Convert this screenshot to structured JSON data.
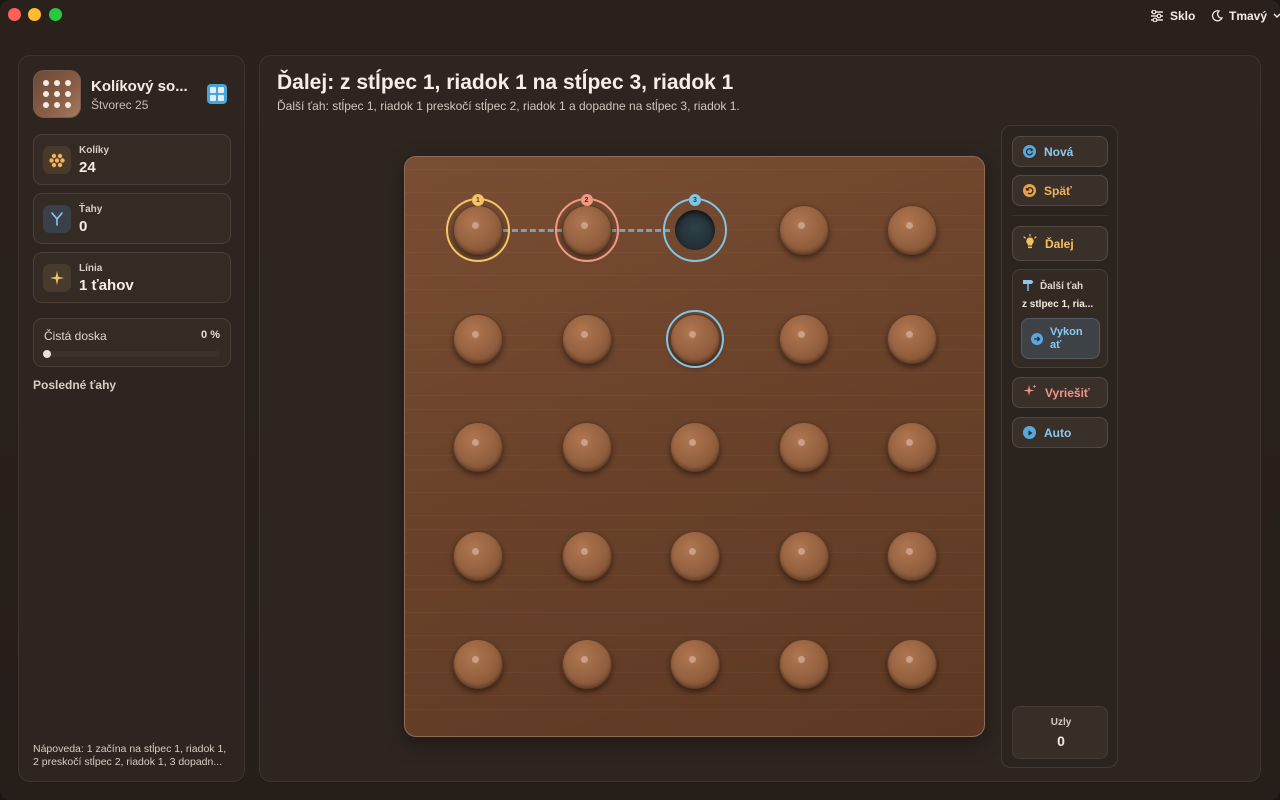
{
  "titlebar": {
    "glass_label": "Sklo",
    "theme_label": "Tmavý"
  },
  "sidebar": {
    "app_title": "Kolíkový so...",
    "app_subtitle": "Štvorec 25",
    "stats": [
      {
        "label": "Kolíky",
        "value": "24",
        "icon": "pegs-icon",
        "color": "#f2b25c"
      },
      {
        "label": "Ťahy",
        "value": "0",
        "icon": "moves-icon",
        "color": "#8cc8ee"
      },
      {
        "label": "Línia",
        "value": "1 ťahov",
        "icon": "sparkle-icon",
        "color": "#f2c163"
      }
    ],
    "progress": {
      "label": "Čistá doska",
      "percent_label": "0 %",
      "fraction": 0
    },
    "recent_title": "Posledné ťahy",
    "hint": "Nápoveda: 1 začína na stĺpec 1, riadok 1, 2 preskočí stĺpec 2, riadok 1, 3 dopadn..."
  },
  "main": {
    "title": "Ďalej: z stĺpec 1, riadok 1 na stĺpec 3, riadok 1",
    "subtitle": "Ďalší ťah: stĺpec 1, riadok 1 preskočí stĺpec 2, riadok 1 a dopadne na stĺpec 3, riadok 1."
  },
  "board": {
    "rows": 5,
    "cols": 5,
    "empty": [
      [
        1,
        3
      ]
    ],
    "highlights": [
      {
        "col": 1,
        "row": 1,
        "style": "yellow",
        "badge": "1"
      },
      {
        "col": 2,
        "row": 1,
        "style": "red",
        "badge": "2"
      },
      {
        "col": 3,
        "row": 1,
        "style": "blue",
        "badge": "3"
      },
      {
        "col": 3,
        "row": 2,
        "style": "blue2",
        "badge": ""
      }
    ]
  },
  "controls": {
    "new_label": "Nová",
    "undo_label": "Späť",
    "next_label": "Ďalej",
    "next_move_title": "Ďalší ťah",
    "next_move_text": "z stĺpec 1, ria...",
    "execute_label": "Vykon ať",
    "solve_label": "Vyriešiť",
    "auto_label": "Auto",
    "nodes_label": "Uzly",
    "nodes_value": "0"
  }
}
